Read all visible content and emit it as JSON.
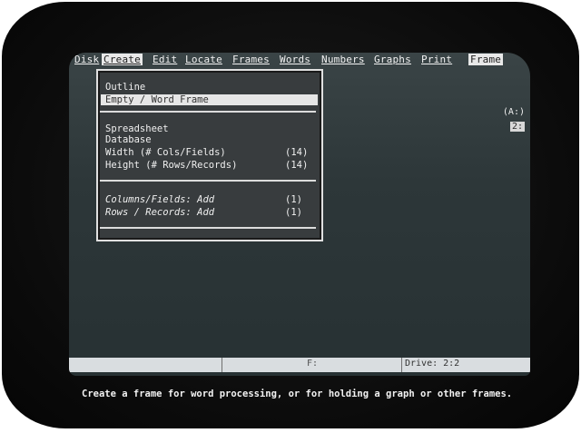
{
  "menubar": {
    "items": [
      {
        "label": "Disk"
      },
      {
        "label": "Create"
      },
      {
        "label": "Edit"
      },
      {
        "label": "Locate"
      },
      {
        "label": "Frames"
      },
      {
        "label": "Words"
      },
      {
        "label": "Numbers"
      },
      {
        "label": "Graphs"
      },
      {
        "label": "Print"
      }
    ],
    "right_label": "Frame"
  },
  "dropdown": {
    "outline": "Outline",
    "empty_word_frame": "Empty / Word Frame",
    "spreadsheet": "Spreadsheet",
    "database": "Database",
    "width_label": "Width  (# Cols/Fields)",
    "width_value": "(14)",
    "height_label": "Height (# Rows/Records)",
    "height_value": "(14)",
    "cols_add_label": "Columns/Fields: Add",
    "cols_add_value": "(1)",
    "rows_add_label": "Rows / Records: Add",
    "rows_add_value": "(1)"
  },
  "side": {
    "drive_a": "(A:)",
    "drive_b": "2:"
  },
  "statusbar": {
    "f_label": "F:",
    "drive_text": "Drive:  2:2"
  },
  "prompt": "Create a frame for word processing, or for holding a graph or other frames."
}
